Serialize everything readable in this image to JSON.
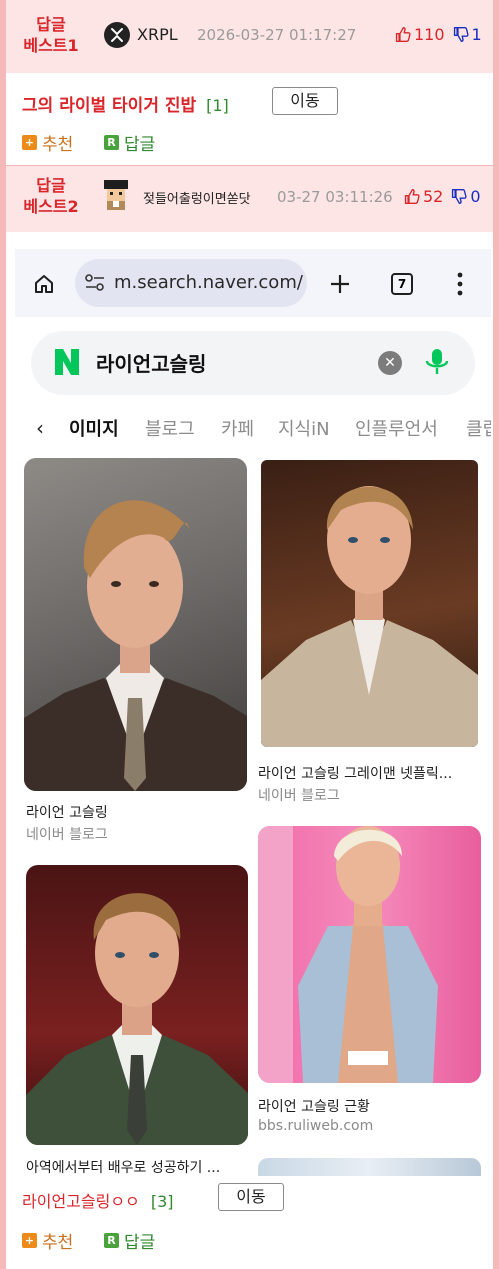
{
  "best1": {
    "label_line1": "답글",
    "label_line2": "베스트1",
    "author": "XRPL",
    "datetime": "2026-03-27 01:17:27",
    "up": "110",
    "down": "1"
  },
  "comment1": {
    "text": "그의 라이벌 타이거 진밥",
    "count": "[1]",
    "move": "이동",
    "recommend": "추천",
    "reply": "답글"
  },
  "best2": {
    "label_line1": "답글",
    "label_line2": "베스트2",
    "author": "젖들어출렁이면쏟닷",
    "datetime": "03-27 03:11:26",
    "up": "52",
    "down": "0"
  },
  "browser": {
    "url": "m.search.naver.com/",
    "tab_count": "7"
  },
  "search": {
    "brand": "N",
    "query": "라이언고슬링"
  },
  "tabs": [
    "이미지",
    "블로그",
    "카페",
    "지식iN",
    "인플루언서",
    "클립"
  ],
  "results": [
    {
      "title": "라이언 고슬링",
      "source": "네이버 블로그"
    },
    {
      "title": "라이언 고슬링 그레이맨 넷플릭...",
      "source": "네이버 블로그"
    },
    {
      "title": "라이언 고슬링 근황",
      "source": "bbs.ruliweb.com"
    },
    {
      "title": "아역에서부터 배우로 성공하기 ...",
      "source": ""
    }
  ],
  "comment2": {
    "text": "라이언고슬링ㅇㅇ",
    "count": "[3]",
    "move": "이동",
    "recommend": "추천",
    "reply": "답글"
  },
  "colors": {
    "accent_red": "#d9262b",
    "vote_blue": "#1b2fbf",
    "naver_green": "#03c75a",
    "frame_pink": "#f6b9b9"
  }
}
